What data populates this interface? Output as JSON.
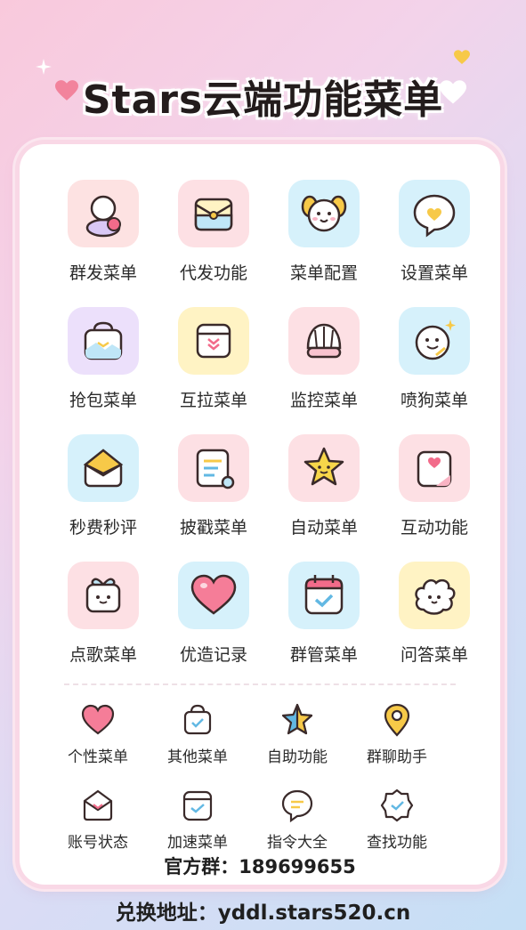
{
  "title": "Stars云端功能菜单",
  "colors": {
    "tile_pink": "#fde0e4",
    "tile_blue": "#d6f1fb",
    "tile_yellow": "#fff3c4",
    "tile_purple": "#ece0fb",
    "accent_pink": "#f26b8a",
    "accent_yellow": "#f7c948",
    "accent_blue": "#62b8e3",
    "outline": "#3a2a2a"
  },
  "main_menu": [
    {
      "label": "群发菜单",
      "icon": "person-icon",
      "bg": "#fde2e2"
    },
    {
      "label": "代发功能",
      "icon": "envelope-icon",
      "bg": "#fde0e4"
    },
    {
      "label": "菜单配置",
      "icon": "puppy-icon",
      "bg": "#d6f1fb"
    },
    {
      "label": "设置菜单",
      "icon": "chat-heart-icon",
      "bg": "#d6f1fb"
    },
    {
      "label": "抢包菜单",
      "icon": "bag-icon",
      "bg": "#ece0fb"
    },
    {
      "label": "互拉菜单",
      "icon": "box-heart-icon",
      "bg": "#fff3c4"
    },
    {
      "label": "监控菜单",
      "icon": "shell-icon",
      "bg": "#fde0e4"
    },
    {
      "label": "喷狗菜单",
      "icon": "smile-sparkle-icon",
      "bg": "#d6f1fb"
    },
    {
      "label": "秒费秒评",
      "icon": "open-envelope-icon",
      "bg": "#d6f1fb"
    },
    {
      "label": "披戳菜单",
      "icon": "note-icon",
      "bg": "#fde0e4"
    },
    {
      "label": "自动菜单",
      "icon": "star-face-icon",
      "bg": "#fde0e4"
    },
    {
      "label": "互动功能",
      "icon": "letter-heart-icon",
      "bg": "#fde0e4"
    },
    {
      "label": "点歌菜单",
      "icon": "gift-face-icon",
      "bg": "#fde0e4"
    },
    {
      "label": "优造记录",
      "icon": "heart-icon",
      "bg": "#d6f1fb"
    },
    {
      "label": "群管菜单",
      "icon": "calendar-check-icon",
      "bg": "#d6f1fb"
    },
    {
      "label": "问答菜单",
      "icon": "cloud-face-icon",
      "bg": "#fff3c4"
    }
  ],
  "sub_menu": [
    {
      "label": "个性菜单",
      "icon": "small-heart-icon"
    },
    {
      "label": "其他菜单",
      "icon": "small-bag-icon"
    },
    {
      "label": "自助功能",
      "icon": "small-star-icon"
    },
    {
      "label": "群聊助手",
      "icon": "location-pin-icon"
    },
    {
      "label": "账号状态",
      "icon": "small-envelope-icon"
    },
    {
      "label": "加速菜单",
      "icon": "small-box-icon"
    },
    {
      "label": "指令大全",
      "icon": "small-chat-icon"
    },
    {
      "label": "查找功能",
      "icon": "small-badge-icon"
    }
  ],
  "group_text": "官方群：189699655",
  "address_text": "兑换地址：yddl.stars520.cn"
}
